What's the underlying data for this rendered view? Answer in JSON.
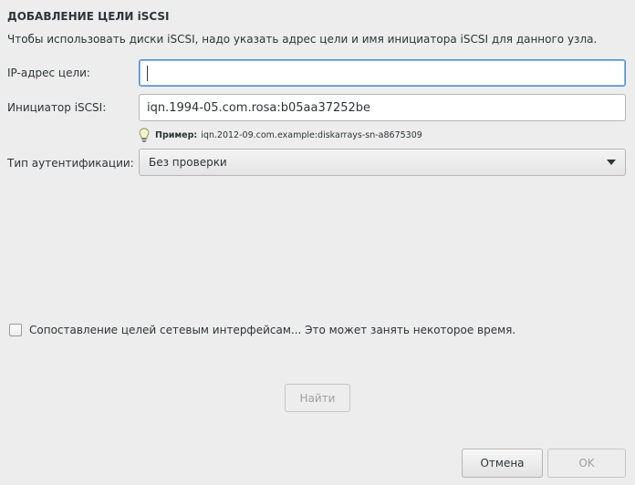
{
  "dialog": {
    "title": "ДОБАВЛЕНИЕ ЦЕЛИ iSCSI",
    "description": "Чтобы использовать диски iSCSI, надо указать адрес цели и имя инициатора iSCSI для данного узла."
  },
  "form": {
    "ip_label": "IP-адрес цели:",
    "ip_value": "",
    "initiator_label": "Инициатор iSCSI:",
    "initiator_value": "iqn.1994-05.com.rosa:b05aa37252be",
    "hint_prefix": "Пример:",
    "hint_example": "iqn.2012-09.com.example:diskarrays-sn-a8675309",
    "auth_label": "Тип аутентификации:",
    "auth_selected": "Без проверки"
  },
  "bind_interfaces": {
    "label": "Сопоставление целей сетевым интерфейсам... Это может занять некоторое время.",
    "checked": false
  },
  "buttons": {
    "find": "Найти",
    "cancel": "Отмена",
    "ok": "OK"
  },
  "icons": {
    "hint": "lightbulb-icon",
    "dropdown": "chevron-down-icon"
  }
}
